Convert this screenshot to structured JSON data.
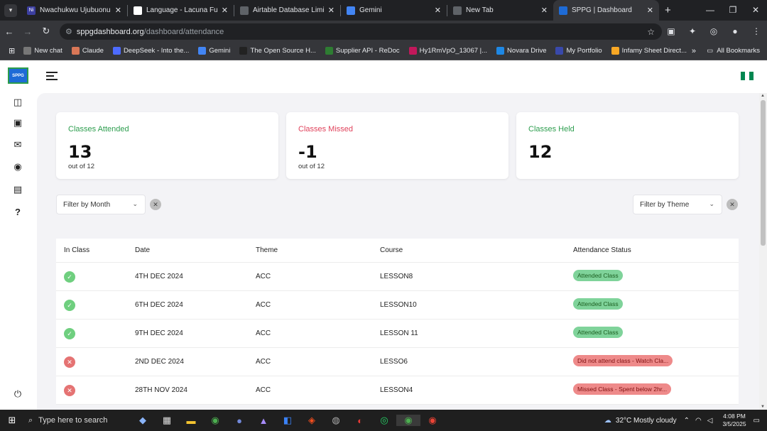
{
  "browser": {
    "tabs": [
      {
        "title": "Nwachukwu Ujubuonu",
        "fav_color": "#3c3fa0",
        "fav_text": "Ni"
      },
      {
        "title": "Language - Lacuna Fund",
        "fav_color": "#ffffff",
        "fav_text": ""
      },
      {
        "title": "Airtable Database Limitatio",
        "fav_color": "#5f6368",
        "fav_text": ""
      },
      {
        "title": "Gemini",
        "fav_color": "#4285f4",
        "fav_text": ""
      },
      {
        "title": "New Tab",
        "fav_color": "#5f6368",
        "fav_text": ""
      },
      {
        "title": "SPPG | Dashboard",
        "fav_color": "#1e6bd6",
        "fav_text": ""
      }
    ],
    "url_host": "sppgdashboard.org",
    "url_path": "/dashboard/attendance",
    "bookmarks": [
      {
        "label": "New chat",
        "color": "#777777"
      },
      {
        "label": "Claude",
        "color": "#d97757"
      },
      {
        "label": "DeepSeek - Into the...",
        "color": "#4d6bfe"
      },
      {
        "label": "Gemini",
        "color": "#4285f4"
      },
      {
        "label": "The Open Source H...",
        "color": "#222222"
      },
      {
        "label": "Supplier API - ReDoc",
        "color": "#2e7d32"
      },
      {
        "label": "Hy1RmVpO_13067 |...",
        "color": "#c2185b"
      },
      {
        "label": "Novara Drive",
        "color": "#1e88e5"
      },
      {
        "label": "My Portfolio",
        "color": "#3949ab"
      },
      {
        "label": "Infamy Sheet Direct...",
        "color": "#f9a825"
      }
    ],
    "all_bookmarks": "All Bookmarks"
  },
  "app": {
    "logo_text": "SPPG",
    "flag_colors": [
      "#008751",
      "#ffffff",
      "#008751"
    ]
  },
  "cards": [
    {
      "label": "Classes Attended",
      "value": "13",
      "sub": "out of 12",
      "color": "#2e9e4f"
    },
    {
      "label": "Classes Missed",
      "value": "-1",
      "sub": "out of 12",
      "color": "#e0435c"
    },
    {
      "label": "Classes Held",
      "value": "12",
      "sub": "",
      "color": "#2e9e4f"
    }
  ],
  "filters": {
    "month": "Filter by Month",
    "theme": "Filter by Theme"
  },
  "table": {
    "headers": [
      "In Class",
      "Date",
      "Theme",
      "Course",
      "Attendance Status"
    ],
    "rows": [
      {
        "present": true,
        "date": "4TH DEC 2024",
        "theme": "ACC",
        "course": "LESSON8",
        "status": "Attended Class"
      },
      {
        "present": true,
        "date": "6TH DEC 2024",
        "theme": "ACC",
        "course": "LESSON10",
        "status": "Attended Class"
      },
      {
        "present": true,
        "date": "9TH DEC 2024",
        "theme": "ACC",
        "course": "LESSON 11",
        "status": "Attended Class"
      },
      {
        "present": false,
        "date": "2ND DEC 2024",
        "theme": "ACC",
        "course": "LESSO6",
        "status": "Did not attend class - Watch Cla..."
      },
      {
        "present": false,
        "date": "28TH NOV 2024",
        "theme": "ACC",
        "course": "LESSON4",
        "status": "Missed Class - Spent below 2hr..."
      }
    ]
  },
  "colors": {
    "present_icon": "#6fcf7f",
    "absent_icon": "#e57373",
    "present_badge_bg": "#7fd39a",
    "present_badge_fg": "#1b5e20",
    "absent_badge_bg": "#ee8a8a",
    "absent_badge_fg": "#7f1010"
  },
  "taskbar": {
    "search_placeholder": "Type here to search",
    "weather": "32°C  Mostly cloudy",
    "time": "4:08 PM",
    "date": "3/5/2025"
  }
}
